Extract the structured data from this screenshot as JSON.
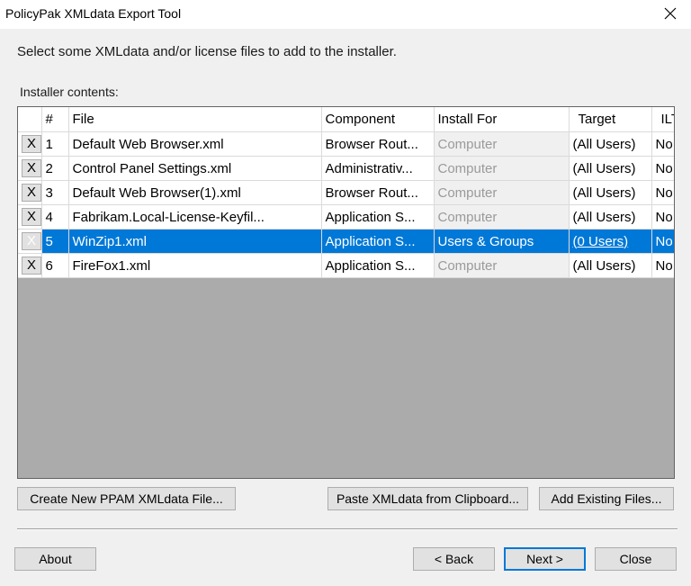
{
  "window": {
    "title": "PolicyPak XMLdata Export Tool",
    "close_icon": "close-icon"
  },
  "instruction": "Select some XMLdata and/or license files to add to the installer.",
  "contents_label": "Installer contents:",
  "grid": {
    "columns": [
      "",
      "#",
      "File",
      "Component",
      "Install For",
      "Target",
      "ILT"
    ],
    "rows": [
      {
        "x": "X",
        "num": "1",
        "file": "Default Web Browser.xml",
        "component": "Browser Rout...",
        "install_for": "Computer",
        "target": "(All Users)",
        "ilt": "No"
      },
      {
        "x": "X",
        "num": "2",
        "file": "Control Panel Settings.xml",
        "component": "Administrativ...",
        "install_for": "Computer",
        "target": "(All Users)",
        "ilt": "No"
      },
      {
        "x": "X",
        "num": "3",
        "file": "Default Web Browser(1).xml",
        "component": "Browser Rout...",
        "install_for": "Computer",
        "target": "(All Users)",
        "ilt": "No"
      },
      {
        "x": "X",
        "num": "4",
        "file": "Fabrikam.Local-License-Keyfil...",
        "component": "Application S...",
        "install_for": "Computer",
        "target": "(All Users)",
        "ilt": "No"
      },
      {
        "x": "X",
        "num": "5",
        "file": "WinZip1.xml",
        "component": "Application S...",
        "install_for": "Users & Groups",
        "target": "(0 Users)",
        "ilt": "No",
        "selected": true
      },
      {
        "x": "X",
        "num": "6",
        "file": "FireFox1.xml",
        "component": "Application S...",
        "install_for": "Computer",
        "target": "(All Users)",
        "ilt": "No"
      }
    ]
  },
  "buttons": {
    "create_new": "Create New PPAM XMLdata File...",
    "paste": "Paste XMLdata from Clipboard...",
    "add_existing": "Add Existing Files...",
    "about": "About",
    "back": "< Back",
    "next": "Next >",
    "close": "Close"
  },
  "colors": {
    "selection": "#0078d7",
    "grid_background": "#ababab",
    "dialog_background": "#f0f0f0"
  }
}
